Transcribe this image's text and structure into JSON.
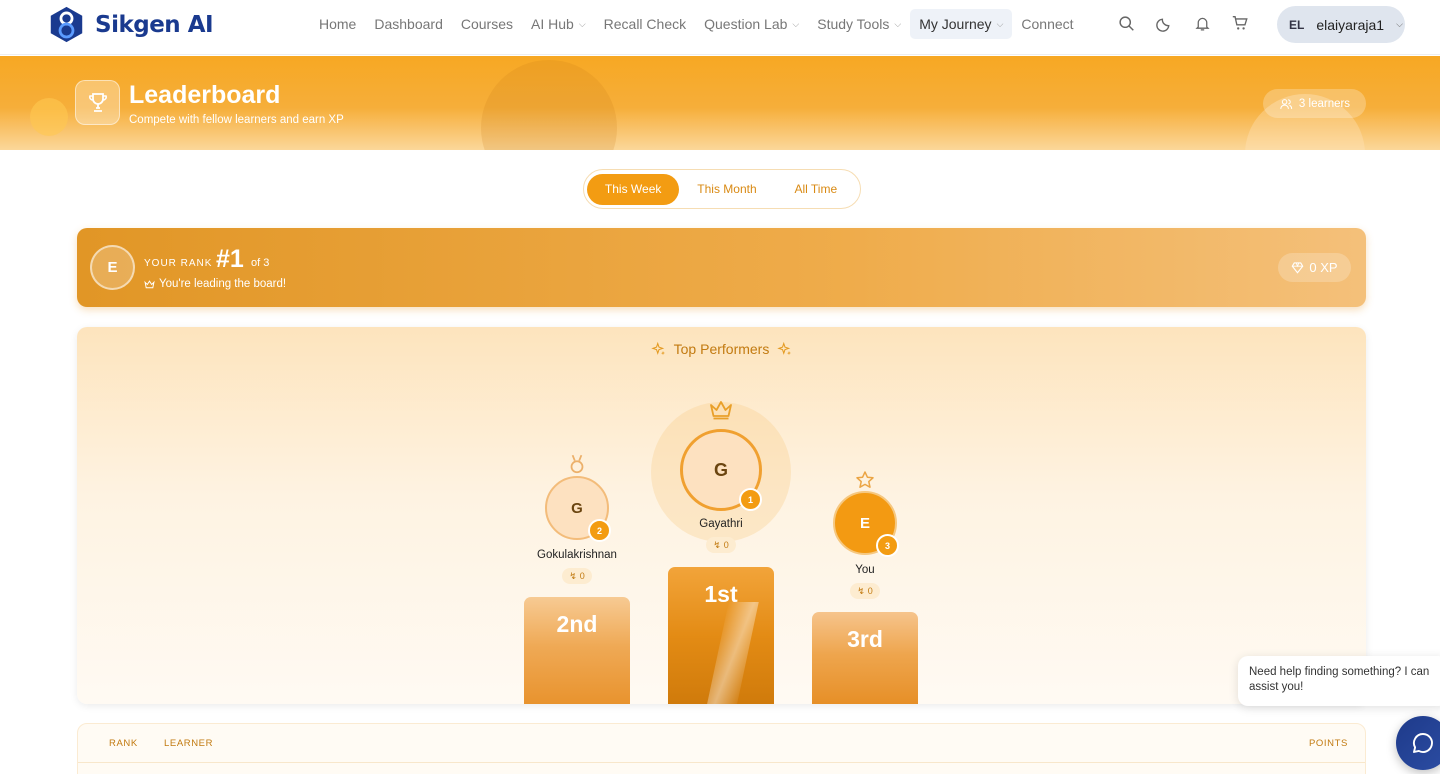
{
  "brand": {
    "name": "Sikgen AI"
  },
  "nav": {
    "links": [
      {
        "label": "Home",
        "dropdown": false,
        "active": false
      },
      {
        "label": "Dashboard",
        "dropdown": false,
        "active": false
      },
      {
        "label": "Courses",
        "dropdown": false,
        "active": false
      },
      {
        "label": "AI Hub",
        "dropdown": true,
        "active": false
      },
      {
        "label": "Recall Check",
        "dropdown": false,
        "active": false
      },
      {
        "label": "Question Lab",
        "dropdown": true,
        "active": false
      },
      {
        "label": "Study Tools",
        "dropdown": true,
        "active": false
      },
      {
        "label": "My Journey",
        "dropdown": true,
        "active": true
      },
      {
        "label": "Connect",
        "dropdown": false,
        "active": false
      }
    ],
    "icons": [
      "search-icon",
      "moon-icon",
      "bell-icon",
      "cart-icon"
    ],
    "user": {
      "initials": "EL",
      "name": "elaiyaraja1"
    }
  },
  "hero": {
    "title": "Leaderboard",
    "subtitle": "Compete with fellow learners and earn XP",
    "learners": "3 learners"
  },
  "tabs": [
    {
      "label": "This Week",
      "active": true
    },
    {
      "label": "This Month",
      "active": false
    },
    {
      "label": "All Time",
      "active": false
    }
  ],
  "rank": {
    "avatar": "E",
    "label": "YOUR RANK",
    "value": "#1",
    "of": "of 3",
    "message": "You're leading the board!",
    "xp": "0 XP"
  },
  "podium": {
    "title": "Top Performers",
    "places": [
      {
        "rank": "2",
        "initial": "G",
        "name": "Gokulakrishnan",
        "xp": "0",
        "label": "2nd",
        "icon": "medal-icon"
      },
      {
        "rank": "1",
        "initial": "G",
        "name": "Gayathri",
        "xp": "0",
        "label": "1st",
        "icon": "crown-icon"
      },
      {
        "rank": "3",
        "initial": "E",
        "name": "You",
        "xp": "0",
        "label": "3rd",
        "icon": "star-icon"
      }
    ]
  },
  "table": {
    "headers": {
      "rank": "RANK",
      "learner": "LEARNER",
      "points": "POINTS"
    }
  },
  "chat": {
    "message": "Need help finding something? I can assist you!"
  },
  "colors": {
    "accent": "#f39c12",
    "brand": "#1a3a8f",
    "text_accent": "#c27a10"
  }
}
